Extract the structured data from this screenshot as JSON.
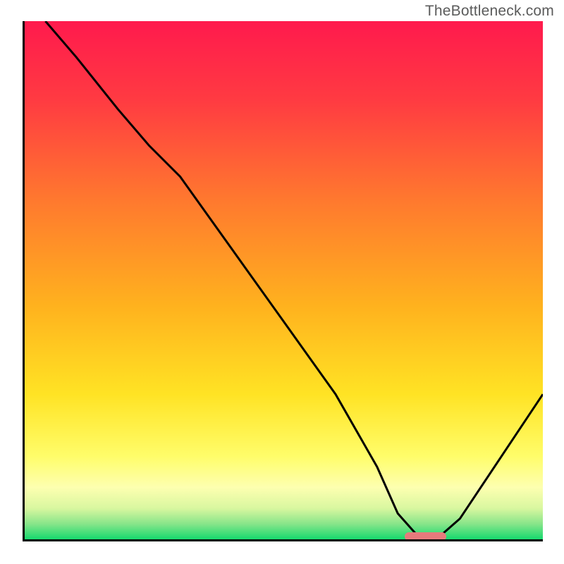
{
  "watermark": "TheBottleneck.com",
  "chart_data": {
    "type": "line",
    "title": "",
    "xlabel": "",
    "ylabel": "",
    "xlim": [
      0,
      100
    ],
    "ylim": [
      0,
      100
    ],
    "x": [
      4,
      10,
      18,
      24,
      30,
      40,
      50,
      60,
      68,
      72,
      76,
      80,
      84,
      100
    ],
    "values": [
      100,
      93,
      83,
      76,
      70,
      56,
      42,
      28,
      14,
      5,
      0.5,
      0.5,
      4,
      28
    ],
    "optimal_marker": {
      "x_start": 73,
      "x_end": 81,
      "y": 0.7
    },
    "gradient_stops": [
      {
        "offset": 0,
        "color": "#ff1a4d"
      },
      {
        "offset": 15,
        "color": "#ff3a42"
      },
      {
        "offset": 35,
        "color": "#ff7a2e"
      },
      {
        "offset": 55,
        "color": "#ffb21e"
      },
      {
        "offset": 72,
        "color": "#ffe324"
      },
      {
        "offset": 84,
        "color": "#fffd6a"
      },
      {
        "offset": 90,
        "color": "#fdffb0"
      },
      {
        "offset": 94,
        "color": "#d9f7a0"
      },
      {
        "offset": 97,
        "color": "#88e58a"
      },
      {
        "offset": 100,
        "color": "#16d96e"
      }
    ]
  }
}
